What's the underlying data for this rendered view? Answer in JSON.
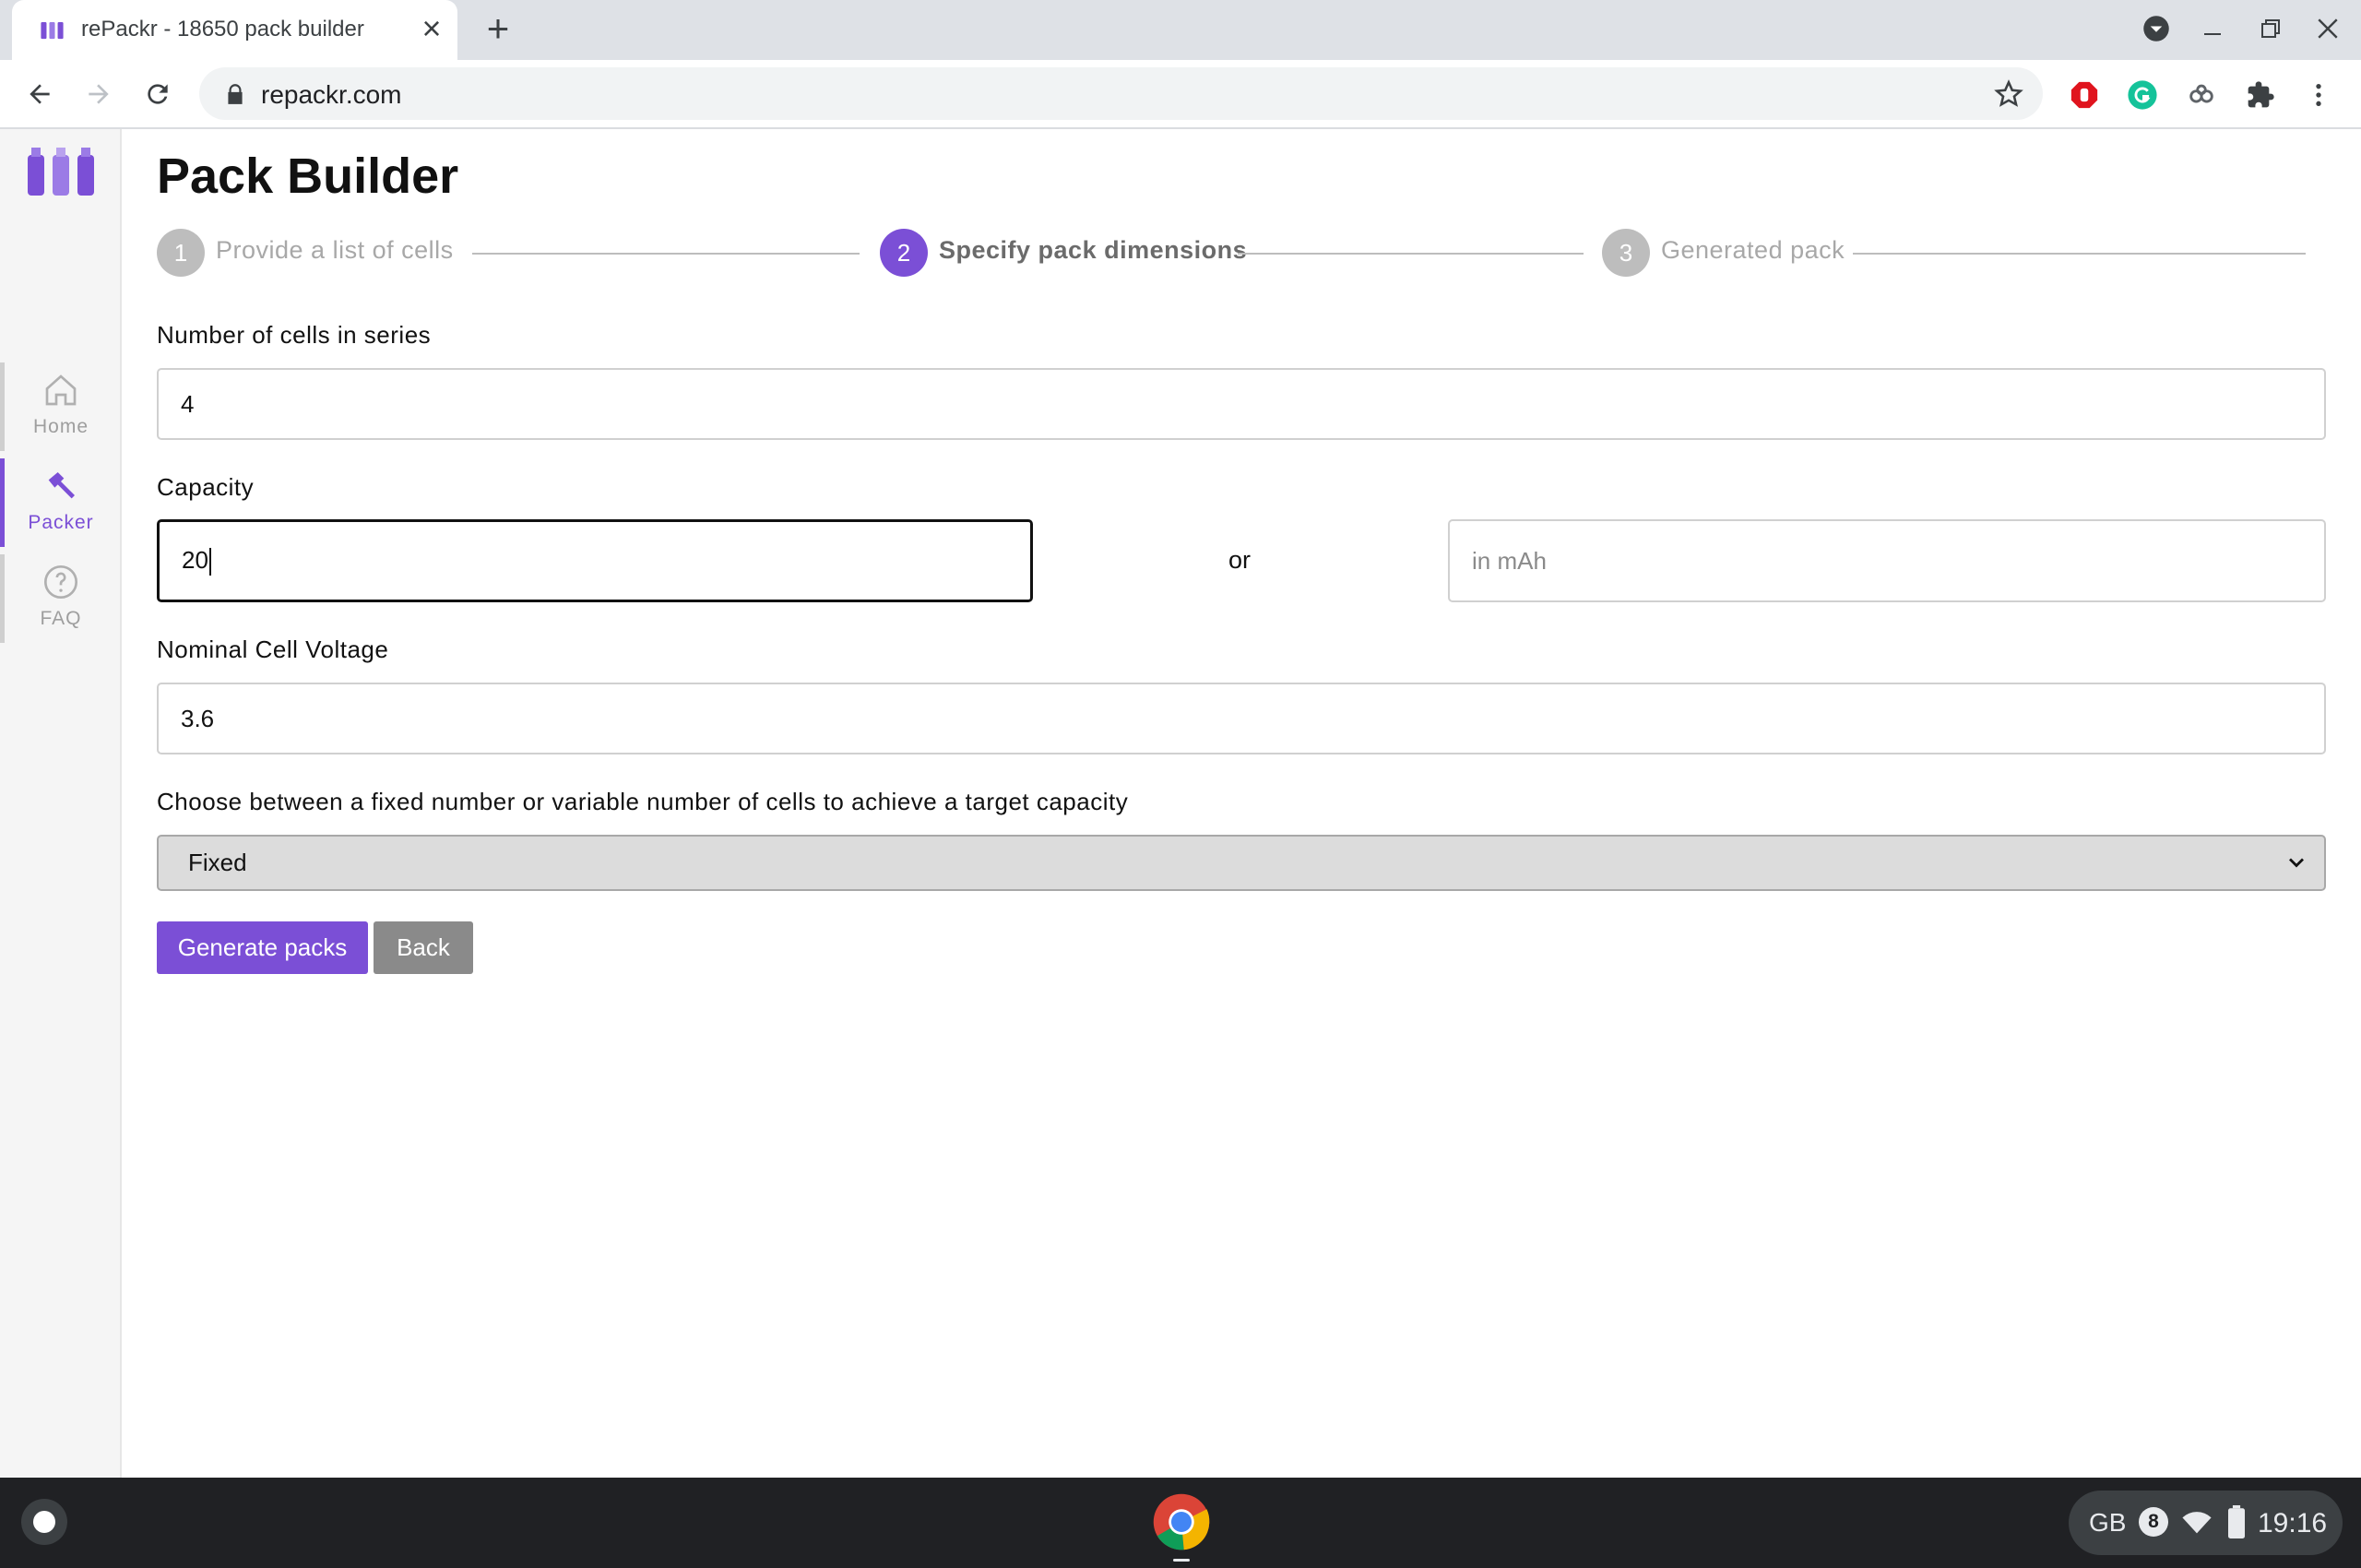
{
  "browser": {
    "tab_title": "rePackr - 18650 pack builder",
    "url": "repackr.com"
  },
  "sidebar": {
    "items": [
      {
        "label": "Home",
        "icon": "home-icon",
        "active": false
      },
      {
        "label": "Packer",
        "icon": "hammer-icon",
        "active": true
      },
      {
        "label": "FAQ",
        "icon": "help-circle-icon",
        "active": false
      }
    ]
  },
  "page": {
    "title": "Pack Builder",
    "steps": [
      {
        "number": "1",
        "label": "Provide a list of cells",
        "state": "completed"
      },
      {
        "number": "2",
        "label": "Specify pack dimensions",
        "state": "active"
      },
      {
        "number": "3",
        "label": "Generated pack",
        "state": "pending"
      }
    ],
    "series": {
      "label": "Number of cells in series",
      "value": "4"
    },
    "capacity": {
      "label": "Capacity",
      "value": "20",
      "separator": "or",
      "alt_placeholder": "in mAh"
    },
    "voltage": {
      "label": "Nominal Cell Voltage",
      "value": "3.6"
    },
    "mode": {
      "label": "Choose between a fixed number or variable number of cells to achieve a target capacity",
      "selected": "Fixed"
    },
    "buttons": {
      "generate": "Generate packs",
      "back": "Back"
    }
  },
  "shelf": {
    "keyboard_layout": "GB",
    "notification_count": "8",
    "time": "19:16"
  },
  "colors": {
    "accent": "#7b4fd6",
    "inactive_step": "#bdbdbd",
    "back_button": "#8a8a8a"
  }
}
